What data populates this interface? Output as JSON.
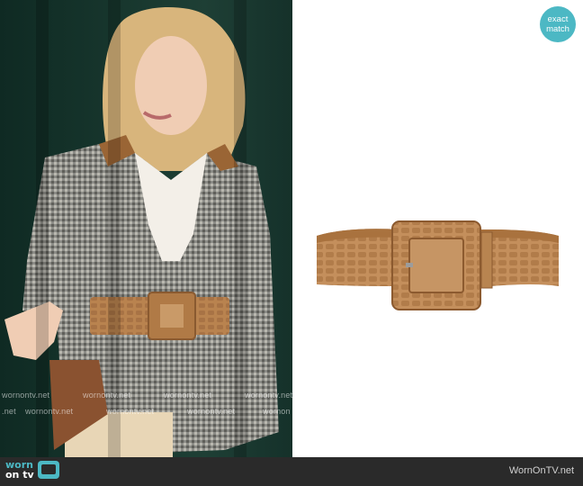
{
  "badge": {
    "line1": "exact",
    "line2": "match"
  },
  "watermarks": [
    "wornontv.net",
    "wornontv.net",
    "wornontv.net",
    "wornontv.net",
    ".net",
    "wornontv.net",
    "wornontv.net",
    "wornontv.net",
    "wornon"
  ],
  "footer": {
    "logo_line1": "worn",
    "logo_line2": "on tv",
    "credit": "WornOnTV.net"
  },
  "colors": {
    "accent": "#4cb8c4",
    "footer_bg": "#2a2a2a",
    "belt": "#c08a56"
  }
}
